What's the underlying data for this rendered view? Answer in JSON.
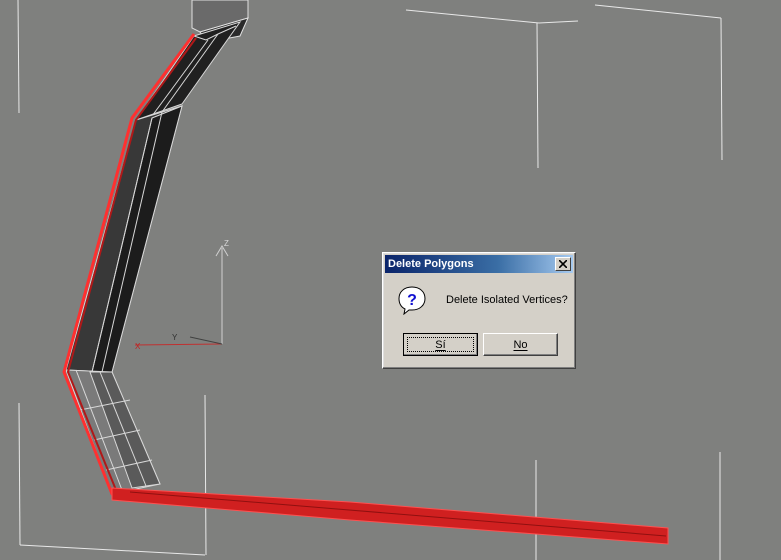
{
  "dialog": {
    "title": "Delete Polygons",
    "message": "Delete Isolated Vertices?",
    "yes_label": "Sí",
    "no_label": "No"
  },
  "viewport": {
    "axis_labels": {
      "z": "Z",
      "x": "X",
      "y": "Y"
    }
  },
  "colors": {
    "viewport_bg": "#7f807e",
    "selection": "#e02020",
    "titlebar_start": "#0a246a",
    "titlebar_end": "#a6caf0",
    "dialog_bg": "#d4d0c8"
  },
  "icons": {
    "close": "close-icon",
    "question": "question-icon"
  }
}
